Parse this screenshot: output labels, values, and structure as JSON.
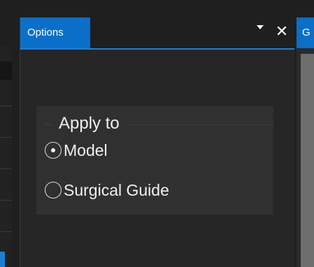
{
  "options_panel": {
    "tab_label": "Options",
    "menu_icon": "triangle-down-icon",
    "close_icon": "close-icon",
    "close_glyph": "✕"
  },
  "apply_to": {
    "title": "Apply to",
    "options": [
      {
        "label": "Model",
        "selected": true
      },
      {
        "label": "Surgical Guide",
        "selected": false
      }
    ]
  },
  "right_panel": {
    "tab_label": "G"
  },
  "colors": {
    "accent": "#0a6fc9",
    "background": "#262626",
    "groupbox": "#303030",
    "text": "#f0f0f0"
  }
}
